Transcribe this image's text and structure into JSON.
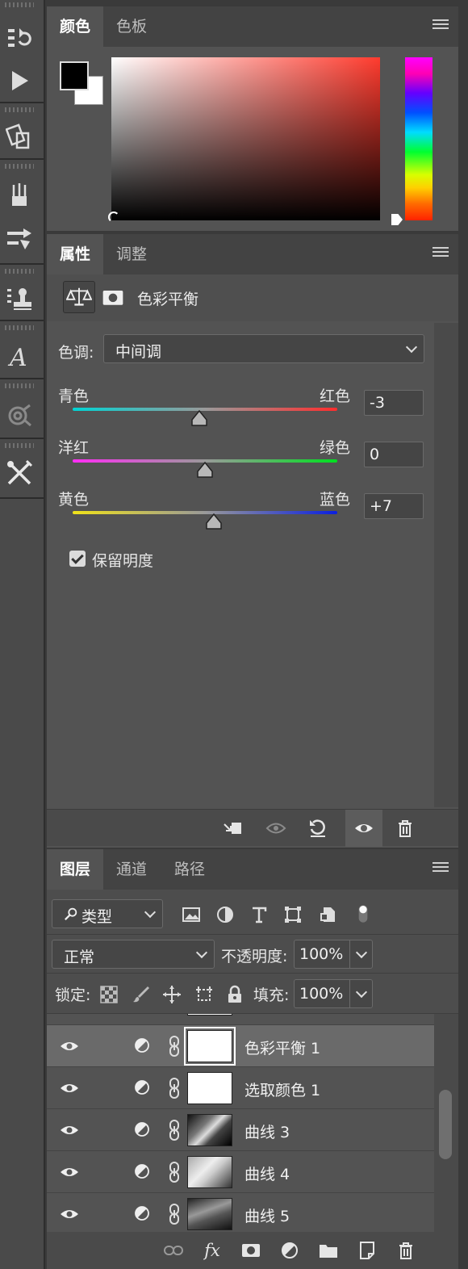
{
  "toolbar": {
    "tools": [
      {
        "icon": "history-icon"
      },
      {
        "icon": "play-icon"
      },
      {
        "icon": "transform-icon"
      },
      {
        "icon": "brushes-icon"
      },
      {
        "icon": "adjust-sliders-icon"
      },
      {
        "icon": "stamp-icon"
      },
      {
        "icon": "glyph-a-icon"
      },
      {
        "icon": "target-icon"
      },
      {
        "icon": "crossed-tools-icon"
      }
    ]
  },
  "color_panel": {
    "tabs": [
      "颜色",
      "色板"
    ],
    "foreground": "#000000",
    "background": "#ffffff",
    "hue_color": "#ff3b2e"
  },
  "properties_panel": {
    "tabs": [
      "属性",
      "调整"
    ],
    "title": "色彩平衡",
    "tone_label": "色调:",
    "tone_value": "中间调",
    "sliders": [
      {
        "left": "青色",
        "right": "红色",
        "value": "-3",
        "fraction": 0.48
      },
      {
        "left": "洋红",
        "right": "绿色",
        "value": "0",
        "fraction": 0.5
      },
      {
        "left": "黄色",
        "right": "蓝色",
        "value": "+7",
        "fraction": 0.535
      }
    ],
    "preserve_luminosity": "保留明度"
  },
  "layers_panel": {
    "tabs": [
      "图层",
      "通道",
      "路径"
    ],
    "filter_type": "类型",
    "blend_mode": "正常",
    "opacity_label": "不透明度:",
    "opacity_value": "100%",
    "lock_label": "锁定:",
    "fill_label": "填充:",
    "fill_value": "100%",
    "layers": [
      {
        "name": "色彩平衡 1",
        "thumb": "white",
        "selected": true
      },
      {
        "name": "选取颜色 1",
        "thumb": "white",
        "selected": false
      },
      {
        "name": "曲线 3",
        "thumb": "photo",
        "selected": false
      },
      {
        "name": "曲线 4",
        "thumb": "photo2",
        "selected": false
      },
      {
        "name": "曲线 5",
        "thumb": "photo3",
        "selected": false
      }
    ],
    "footer_fx": "fx"
  }
}
